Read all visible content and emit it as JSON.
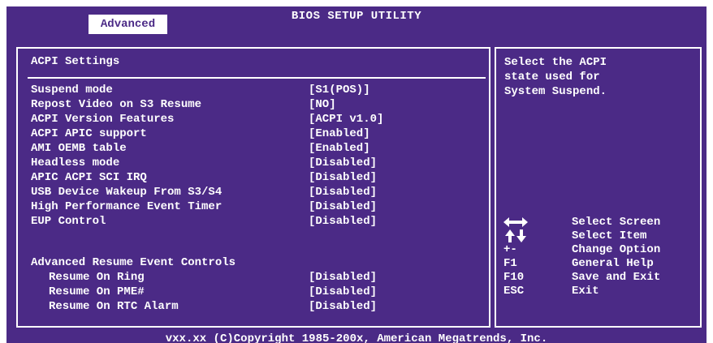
{
  "window": {
    "title": "BIOS SETUP UTILITY",
    "active_tab": "Advanced"
  },
  "main": {
    "section_title": "ACPI Settings",
    "items": [
      {
        "label": "Suspend mode",
        "value": "[S1(POS)]",
        "selected": true
      },
      {
        "label": "Repost Video on S3 Resume",
        "value": "[NO]"
      },
      {
        "label": "ACPI Version Features",
        "value": "[ACPI v1.0]"
      },
      {
        "label": "ACPI APIC support",
        "value": "[Enabled]"
      },
      {
        "label": "AMI OEMB table",
        "value": "[Enabled]"
      },
      {
        "label": "Headless mode",
        "value": "[Disabled]"
      },
      {
        "label": "APIC ACPI SCI IRQ",
        "value": "[Disabled]"
      },
      {
        "label": "USB Device Wakeup From S3/S4",
        "value": "[Disabled]"
      },
      {
        "label": "High Performance Event Timer",
        "value": "[Disabled]"
      },
      {
        "label": "EUP Control",
        "value": "[Disabled]"
      }
    ],
    "group_title": "Advanced Resume Event Controls",
    "group_items": [
      {
        "label": "Resume On Ring",
        "value": "[Disabled]"
      },
      {
        "label": "Resume On PME#",
        "value": "[Disabled]"
      },
      {
        "label": "Resume On RTC Alarm",
        "value": "[Disabled]"
      }
    ]
  },
  "help": {
    "lines": [
      "Select the ACPI",
      "state used for",
      "System Suspend."
    ]
  },
  "keys": [
    {
      "key": "",
      "icon": "left-right-arrows-icon",
      "desc": "Select Screen"
    },
    {
      "key": "",
      "icon": "up-down-arrows-icon",
      "desc": "Select Item"
    },
    {
      "key": "+-",
      "desc": "Change Option"
    },
    {
      "key": "F1",
      "desc": "General Help"
    },
    {
      "key": "F10",
      "desc": "Save and Exit"
    },
    {
      "key": "ESC",
      "desc": "Exit"
    }
  ],
  "footer": {
    "text": "vxx.xx (C)Copyright 1985-200x, American Megatrends, Inc."
  },
  "colors": {
    "background": "#4b2a86",
    "text": "#ffffff"
  }
}
